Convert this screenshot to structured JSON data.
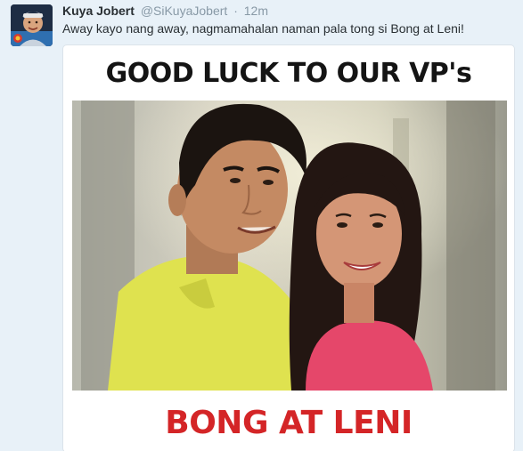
{
  "tweet": {
    "display_name": "Kuya Jobert",
    "handle": "@SiKuyaJobert",
    "separator": "·",
    "time": "12m",
    "text": "Away kayo nang away, nagmamahalan naman pala tong si Bong at Leni!"
  },
  "media": {
    "headline": "GOOD LUCK TO OUR VP's",
    "caption": "BONG AT LENI"
  },
  "colors": {
    "background": "#e8f1f8",
    "name": "#292f33",
    "meta": "#8899a6",
    "caption_red": "#d42527"
  }
}
